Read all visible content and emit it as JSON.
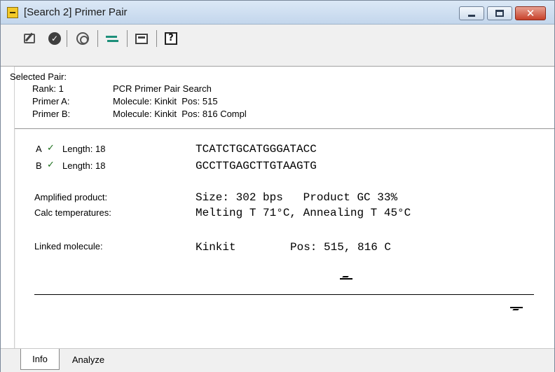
{
  "window": {
    "title": "[Search 2] Primer Pair",
    "controls": {
      "minimize": "minimize",
      "maximize": "maximize",
      "close": "✕"
    }
  },
  "toolbar": {
    "buttons": [
      {
        "icon": "edit-icon"
      },
      {
        "icon": "check-circle-icon"
      },
      {
        "icon": "link-icon"
      },
      {
        "icon": "swap-icon"
      },
      {
        "icon": "window-icon"
      },
      {
        "icon": "help-icon",
        "glyph": "?"
      }
    ]
  },
  "selected_pair": {
    "heading": "Selected Pair:",
    "rows": [
      {
        "label": "Rank: 1",
        "value": "PCR Primer Pair Search"
      },
      {
        "label": "Primer A:",
        "value": "Molecule: Kinkit  Pos: 515"
      },
      {
        "label": "Primer B:",
        "value": "Molecule: Kinkit  Pos: 816 Compl"
      }
    ]
  },
  "primers": {
    "a": {
      "letter": "A",
      "check": "✓",
      "length": "Length: 18",
      "sequence": "TCATCTGCATGGGATACC"
    },
    "b": {
      "letter": "B",
      "check": "✓",
      "length": "Length: 18",
      "sequence": "GCCTTGAGCTTGTAAGTG"
    }
  },
  "details": {
    "amplified_label": "Amplified product:",
    "amplified_value": "Size: 302 bps   Product GC 33%",
    "calc_label": "Calc temperatures:",
    "calc_value": "Melting T 71°C, Annealing T 45°C",
    "linked_label": "Linked molecule:",
    "linked_molecule": "Kinkit",
    "linked_pos": "Pos: 515, 816 C"
  },
  "tabs": {
    "info": "Info",
    "analyze": "Analyze",
    "active": "Info"
  }
}
